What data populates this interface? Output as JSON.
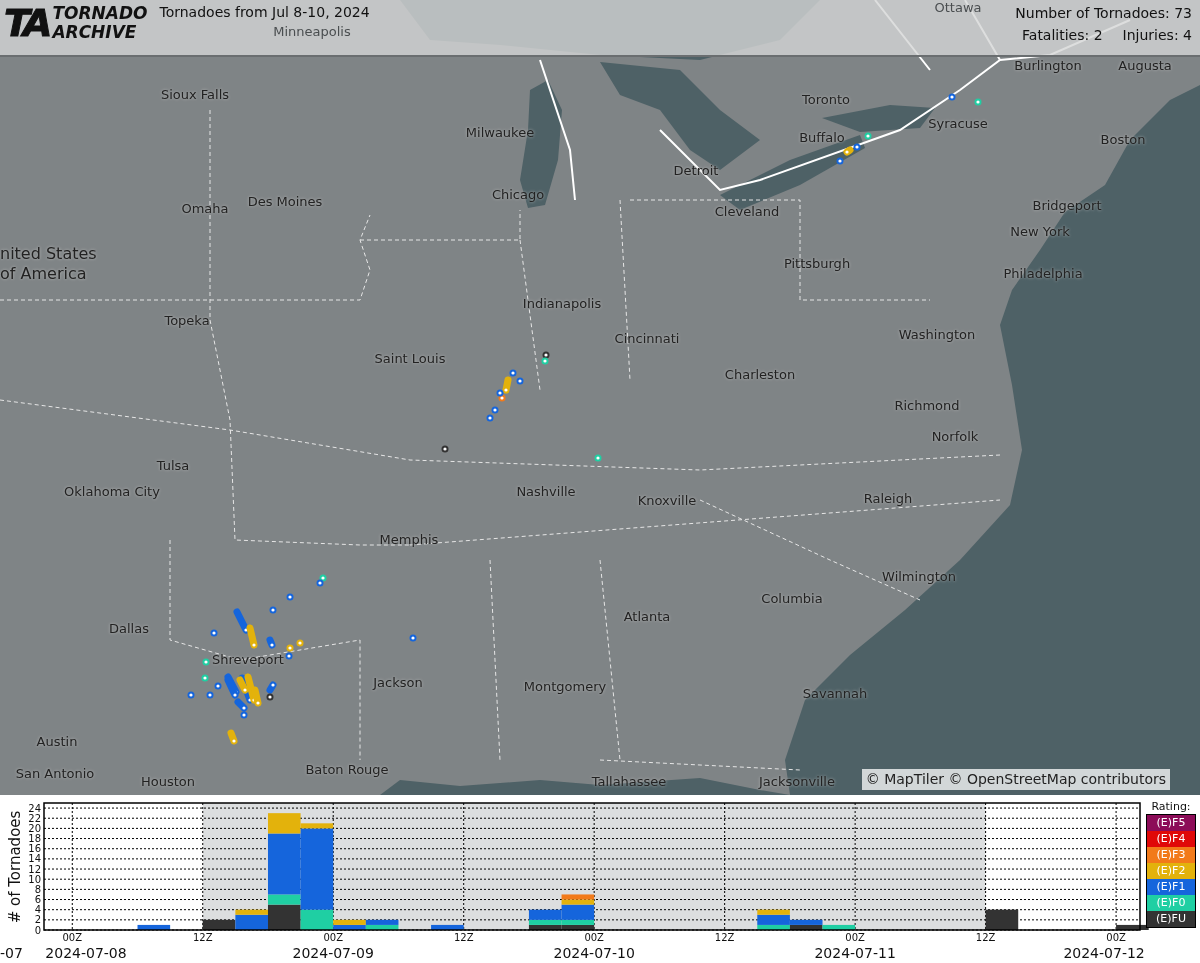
{
  "header": {
    "logo": {
      "mark": "TA",
      "line1": "TORNADO",
      "line2": "ARCHIVE"
    },
    "title": "Tornadoes from Jul 8-10, 2024",
    "count": "Number of Tornadoes: 73",
    "fatalities": "Fatalities: 2",
    "injuries": "Injuries: 4"
  },
  "map": {
    "country_label": [
      "nited States",
      "of America"
    ],
    "cities": [
      "Minneapolis",
      "Ottawa",
      "Burlington",
      "Augusta",
      "Sioux Falls",
      "Milwaukee",
      "Toronto",
      "Syracuse",
      "Boston",
      "Buffalo",
      "Detroit",
      "Chicago",
      "Omaha",
      "Des Moines",
      "Cleveland",
      "Bridgeport",
      "New York",
      "Pittsburgh",
      "Philadelphia",
      "Indianapolis",
      "Topeka",
      "Washington",
      "Cincinnati",
      "Saint Louis",
      "Charleston",
      "Richmond",
      "Norfolk",
      "Tulsa",
      "Oklahoma City",
      "Nashville",
      "Knoxville",
      "Raleigh",
      "Memphis",
      "Wilmington",
      "Columbia",
      "Atlanta",
      "Dallas",
      "Shreveport",
      "Jackson",
      "Montgomery",
      "Savannah",
      "Austin",
      "San Antonio",
      "Houston",
      "Baton Rouge",
      "Tallahassee",
      "Jacksonville"
    ],
    "attribution": "© MapTiler © OpenStreetMap contributors"
  },
  "chart": {
    "date_labels": [
      "-07",
      "2024-07-08",
      "2024-07-09",
      "2024-07-10",
      "2024-07-11",
      "2024-07-12"
    ],
    "legend_title": "Rating:",
    "time_ticks": [
      {
        "label": "00Z",
        "shaded_after": false
      },
      {
        "label": "12Z",
        "shaded_after": true
      },
      {
        "label": "00Z",
        "shaded_after": true
      },
      {
        "label": "12Z",
        "shaded_after": true
      },
      {
        "label": "00Z",
        "shaded_after": true
      },
      {
        "label": "12Z",
        "shaded_after": true
      },
      {
        "label": "00Z",
        "shaded_after": true
      },
      {
        "label": "12Z",
        "shaded_after": false
      },
      {
        "label": "00Z",
        "shaded_after": false
      }
    ],
    "chart_data": {
      "type": "bar",
      "stacked": true,
      "ylabel": "# of Tornadoes",
      "ylim": [
        0,
        25
      ],
      "yticks": [
        0,
        2,
        4,
        6,
        8,
        10,
        12,
        14,
        16,
        18,
        20,
        22,
        24
      ],
      "grid": true,
      "categories": [
        null,
        null,
        null,
        null,
        null,
        null,
        null,
        null,
        null,
        null,
        null,
        null,
        null,
        null,
        null,
        null,
        null,
        null,
        null,
        null,
        null,
        null,
        null,
        null,
        null,
        null,
        null,
        null,
        null,
        null,
        null,
        null,
        null,
        null
      ],
      "series": [
        {
          "name": "(E)FU",
          "color": "#333333",
          "values": [
            0,
            0,
            0,
            0,
            0,
            2,
            0,
            5,
            0,
            0,
            0,
            0,
            0,
            0,
            0,
            1,
            1,
            0,
            0,
            0,
            0,
            0,
            0,
            1,
            0,
            0,
            0,
            0,
            0,
            4,
            0,
            0,
            0,
            1
          ]
        },
        {
          "name": "(E)F0",
          "color": "#1fcfa3",
          "values": [
            0,
            0,
            0,
            0,
            0,
            0,
            0,
            2,
            4,
            0,
            1,
            0,
            0,
            0,
            0,
            1,
            1,
            0,
            0,
            0,
            0,
            0,
            1,
            0,
            1,
            0,
            0,
            0,
            0,
            0,
            0,
            0,
            0,
            0
          ]
        },
        {
          "name": "(E)F1",
          "color": "#1565dc",
          "values": [
            0,
            0,
            0,
            1,
            0,
            0,
            3,
            12,
            16,
            1,
            1,
            0,
            1,
            0,
            0,
            2,
            3,
            0,
            0,
            0,
            0,
            0,
            2,
            1,
            0,
            0,
            0,
            0,
            0,
            0,
            0,
            0,
            0,
            0
          ]
        },
        {
          "name": "(E)F2",
          "color": "#e3b20c",
          "values": [
            0,
            0,
            0,
            0,
            0,
            0,
            1,
            4,
            1,
            1,
            0,
            0,
            0,
            0,
            0,
            0,
            1,
            0,
            0,
            0,
            0,
            0,
            1,
            0,
            0,
            0,
            0,
            0,
            0,
            0,
            0,
            0,
            0,
            0
          ]
        },
        {
          "name": "(E)F3",
          "color": "#f27a1a",
          "values": [
            0,
            0,
            0,
            0,
            0,
            0,
            0,
            0,
            0,
            0,
            0,
            0,
            0,
            0,
            0,
            0,
            1,
            0,
            0,
            0,
            0,
            0,
            0,
            0,
            0,
            0,
            0,
            0,
            0,
            0,
            0,
            0,
            0,
            0
          ]
        },
        {
          "name": "(E)F4",
          "color": "#e00808",
          "values": [
            0,
            0,
            0,
            0,
            0,
            0,
            0,
            0,
            0,
            0,
            0,
            0,
            0,
            0,
            0,
            0,
            0,
            0,
            0,
            0,
            0,
            0,
            0,
            0,
            0,
            0,
            0,
            0,
            0,
            0,
            0,
            0,
            0,
            0
          ]
        },
        {
          "name": "(E)F5",
          "color": "#8c0c58",
          "values": [
            0,
            0,
            0,
            0,
            0,
            0,
            0,
            0,
            0,
            0,
            0,
            0,
            0,
            0,
            0,
            0,
            0,
            0,
            0,
            0,
            0,
            0,
            0,
            0,
            0,
            0,
            0,
            0,
            0,
            0,
            0,
            0,
            0,
            0
          ]
        }
      ]
    }
  }
}
